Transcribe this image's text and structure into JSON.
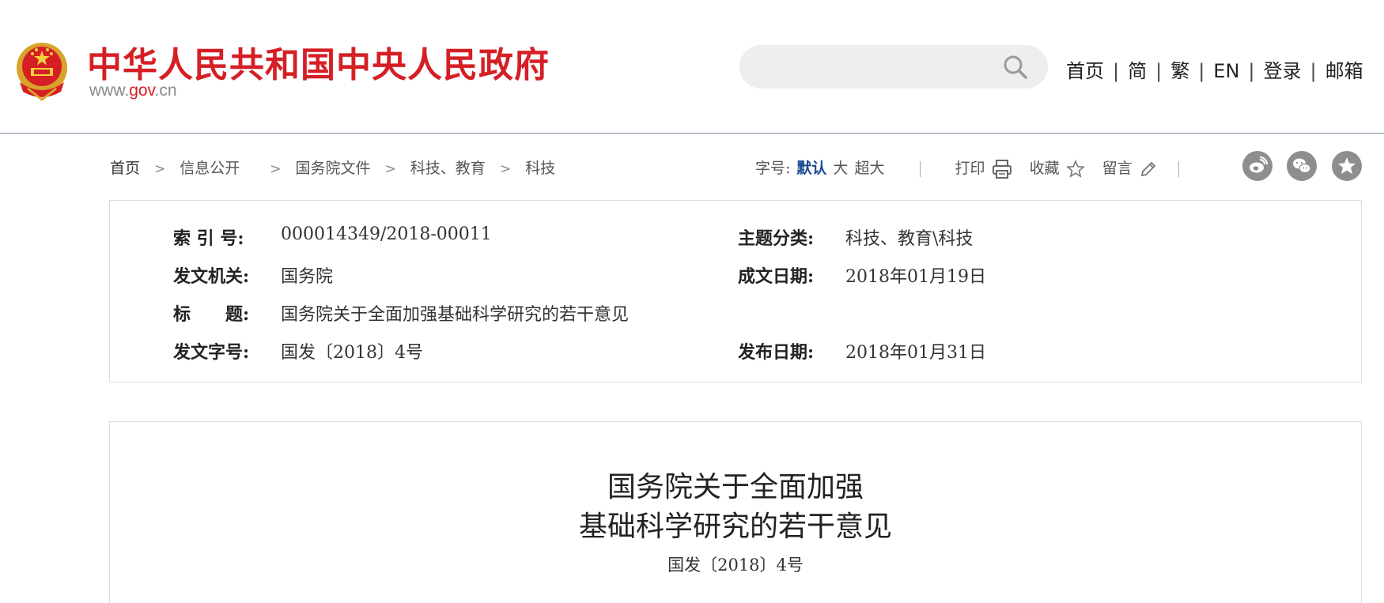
{
  "header": {
    "site_title": "中华人民共和国中央人民政府",
    "url_prefix": "www.",
    "url_highlight": "gov",
    "url_suffix": ".cn",
    "search": {
      "placeholder": "",
      "value": ""
    },
    "nav": [
      "首页",
      "简",
      "繁",
      "EN",
      "登录",
      "邮箱"
    ],
    "nav_separator": "|"
  },
  "breadcrumb": {
    "items": [
      "首页",
      "信息公开",
      "国务院文件",
      "科技、教育",
      "科技"
    ],
    "separator": ">"
  },
  "toolbar": {
    "font_size_label": "字号:",
    "font_options": [
      "默认",
      "大",
      "超大"
    ],
    "active_font_option": "默认",
    "print_label": "打印",
    "favorite_label": "收藏",
    "comment_label": "留言"
  },
  "share": [
    "weibo-icon",
    "wechat-icon",
    "favorite-star-icon"
  ],
  "info": {
    "index_label": "索 引 号:",
    "index_value": "000014349/2018-00011",
    "topic_label": "主题分类:",
    "topic_value": "科技、教育\\科技",
    "issuer_label": "发文机关:",
    "issuer_value": "国务院",
    "written_date_label": "成文日期:",
    "written_date_value": "2018年01月19日",
    "title_label": "标　　题:",
    "title_value": "国务院关于全面加强基础科学研究的若干意见",
    "doc_no_label": "发文字号:",
    "doc_no_value": "国发〔2018〕4号",
    "publish_date_label": "发布日期:",
    "publish_date_value": "2018年01月31日"
  },
  "article": {
    "title_line1": "国务院关于全面加强",
    "title_line2": "基础科学研究的若干意见",
    "doc_number": "国发〔2018〕4号"
  },
  "colors": {
    "brand_red": "#d51f25",
    "link_blue": "#1b4a94",
    "icon_gray": "#8e8e8e"
  }
}
